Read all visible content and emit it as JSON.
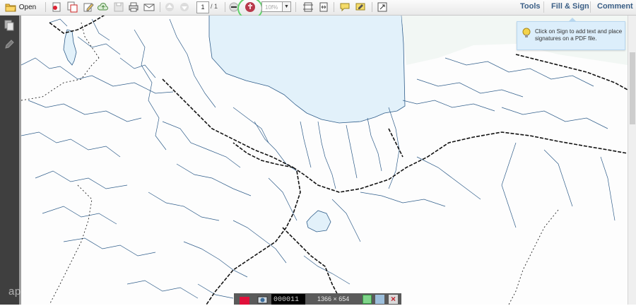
{
  "toolbar": {
    "open_label": "Open",
    "page_current": "1",
    "page_total": "/ 1",
    "zoom_value": "10f%",
    "zoom_dropdown_icon": "chevron-down-icon",
    "tools_label": "Tools",
    "fill_sign_label": "Fill & Sign",
    "comment_label": "Comment"
  },
  "tooltip": {
    "text": "Click on Sign to add text and place signatures on a PDF file."
  },
  "recorder": {
    "time": "000011",
    "size": "1366 × 654"
  },
  "watermark": {
    "text": "ap"
  },
  "colors": {
    "toolbar_link": "#3b5f86",
    "lake": "#e2f1fa",
    "river": "#2f5d8a",
    "rail": "#111111",
    "highlight": "#62d36c",
    "record_red": "#e0103a"
  }
}
